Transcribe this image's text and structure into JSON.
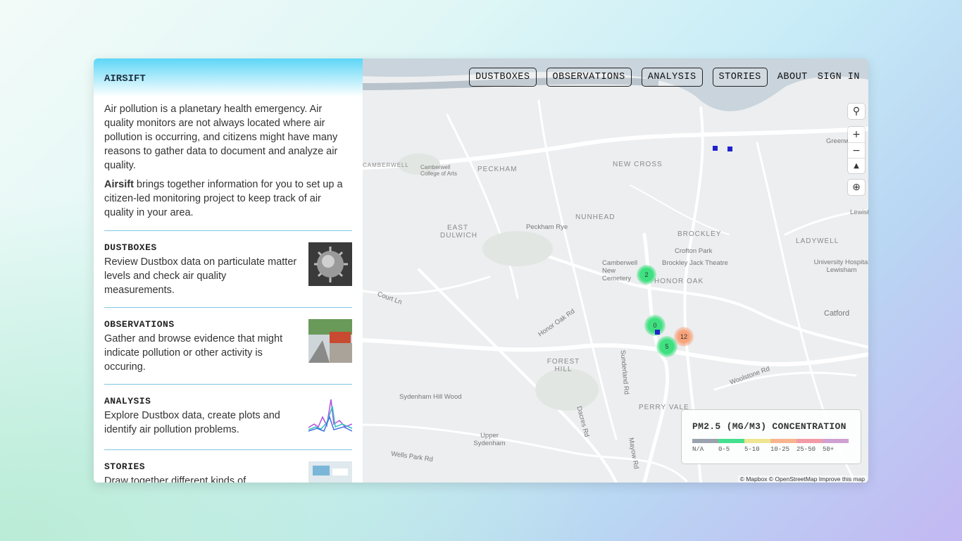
{
  "brand": "AIRSIFT",
  "intro": {
    "p1": "Air pollution is a planetary health emergency. Air quality monitors are not always located where air pollution is occurring, and citizens might have many reasons to gather data to document and analyze air quality.",
    "p2_bold": "Airsift",
    "p2": " brings together information for you to set up a citizen-led monitoring project to keep track of air quality in your area."
  },
  "sections": [
    {
      "title": "DUSTBOXES",
      "text": "Review Dustbox data on particulate matter levels and check air quality measurements."
    },
    {
      "title": "OBSERVATIONS",
      "text": "Gather and browse evidence that might indicate pollution or other activity is occuring."
    },
    {
      "title": "ANALYSIS",
      "text": "Explore Dustbox data, create plots and identify air pollution problems."
    },
    {
      "title": "STORIES",
      "text": "Draw together different kinds of"
    }
  ],
  "nav": {
    "dustboxes": "DUSTBOXES",
    "observations": "OBSERVATIONS",
    "analysis": "ANALYSIS",
    "stories": "STORIES",
    "about": "ABOUT",
    "signin": "SIGN IN"
  },
  "map_controls": {
    "search": "search-icon",
    "zoom_in": "+",
    "zoom_out": "−",
    "compass": "compass-icon",
    "locate": "geolocate-icon"
  },
  "clusters": [
    {
      "count": "2",
      "color": "#3ee07f"
    },
    {
      "count": "0",
      "color": "#3ee07f"
    },
    {
      "count": "5",
      "color": "#3ee07f"
    },
    {
      "count": "12",
      "color": "#f7a27a"
    }
  ],
  "map_labels": [
    "NUNHEAD",
    "Peckham Rye",
    "BROCKLEY",
    "Crofton Park",
    "HONOR OAK",
    "FOREST HILL",
    "PERRY VALE",
    "Catford",
    "Sydenham Hill Wood",
    "Upper Sydenham",
    "EAST DULWICH",
    "NEW CROSS",
    "PECKHAM",
    "Lewisham",
    "Greenwich",
    "LADYWELL",
    "Brockley Jack Theatre",
    "Camberwell New Cemetery",
    "University Hospital Lewisham",
    "Honor Oak Rd",
    "Wells Park Rd",
    "Court Ln",
    "Woolstone Rd",
    "Sunderland Rd",
    "Dacres Rd",
    "Mayow Rd",
    "Camberwell College of Arts",
    "CAMBERWELL"
  ],
  "legend": {
    "title": "PM2.5 (MG/M3) CONCENTRATION",
    "bins": [
      {
        "label": "N/A",
        "color": "#9aa3ad"
      },
      {
        "label": "0-5",
        "color": "#45e08d"
      },
      {
        "label": "5-10",
        "color": "#ede58f"
      },
      {
        "label": "10-25",
        "color": "#f8b48f"
      },
      {
        "label": "25-50",
        "color": "#f29aa6"
      },
      {
        "label": "50+",
        "color": "#cfa0d2"
      }
    ]
  },
  "attribution": "© Mapbox © OpenStreetMap Improve this map"
}
